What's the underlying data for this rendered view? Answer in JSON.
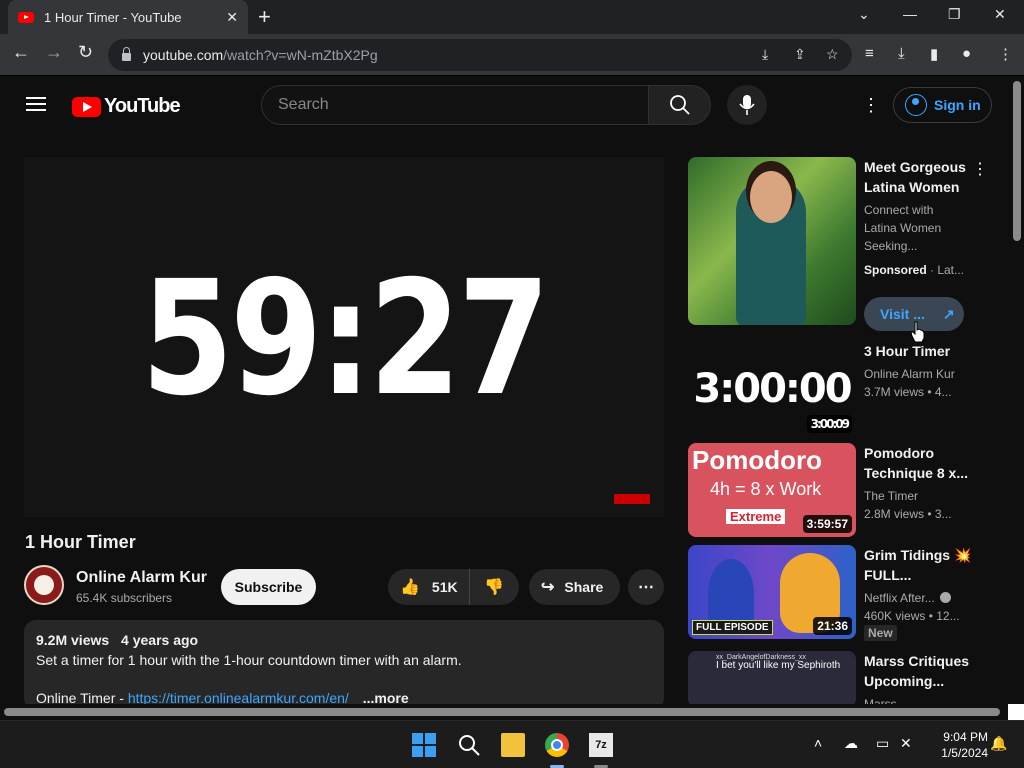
{
  "browser": {
    "tab_title": "1 Hour Timer - YouTube",
    "url_host": "youtube.com",
    "url_path": "/watch?v=wN-mZtbX2Pg"
  },
  "yt": {
    "logo_text": "YouTube",
    "search_placeholder": "Search",
    "signin_label": "Sign in"
  },
  "player": {
    "countdown": "59:27"
  },
  "video": {
    "title": "1 Hour Timer",
    "channel_name": "Online Alarm Kur",
    "subscribers": "65.4K subscribers",
    "subscribe_label": "Subscribe",
    "likes": "51K",
    "share_label": "Share",
    "views": "9.2M views",
    "age": "4 years ago",
    "description_line1": "Set a timer for 1 hour with the 1-hour countdown timer with an alarm.",
    "description_prefix": "Online Timer - ",
    "description_link": "https://timer.onlinealarmkur.com/en/",
    "more_label": "...more"
  },
  "sidebar": {
    "ad": {
      "title": "Meet Gorgeous Latina Women",
      "line1": "Connect with",
      "line2": "Latina Women",
      "line3": "Seeking...",
      "sponsored": "Sponsored",
      "advertiser": " · Lat...",
      "visit_label": "Visit ..."
    },
    "videos": [
      {
        "title": "3 Hour Timer",
        "channel": "Online Alarm Kur",
        "meta": "3.7M views  • 4...",
        "duration": "3:00:09",
        "thumb_text": "3:00:00"
      },
      {
        "title": "Pomodoro Technique 8 x...",
        "channel": "The Timer",
        "meta": "2.8M views  • 3...",
        "duration": "3:59:57",
        "thumb_title": "Pomodoro",
        "thumb_sub": "4h = 8 x Work",
        "thumb_badge": "Extreme"
      },
      {
        "title": "Grim Tidings 💥 FULL...",
        "channel": "Netflix After...",
        "meta": "460K views  • 12...",
        "duration": "21:36",
        "badge": "New",
        "thumb_label": "FULL EPISODE"
      },
      {
        "title": "Marss Critiques Upcoming...",
        "channel": "Marss",
        "thumb_user": "xx_DarkAngelofDarkness_xx",
        "thumb_caption": "I bet you'll like my Sephiroth"
      }
    ]
  },
  "taskbar": {
    "time": "9:04 PM",
    "date": "1/5/2024",
    "archiver_label": "7z"
  },
  "icons": {
    "close": "✕",
    "plus": "+",
    "back": "←",
    "forward": "→",
    "reload": "↻",
    "star": "☆",
    "kebab": "⋮",
    "more": "⋯",
    "like": "👍",
    "dislike": "👎",
    "share": "↪",
    "external": "↗",
    "search": "⌕",
    "mic": "🎤",
    "minimize": "—",
    "restore": "❐",
    "chevron": "⌄",
    "caret-up": "˄"
  },
  "colors": {
    "youtube_red": "#ff0000",
    "link_blue": "#3ea6ff",
    "page_bg": "#0f0f0f",
    "pill_bg": "#272727"
  }
}
